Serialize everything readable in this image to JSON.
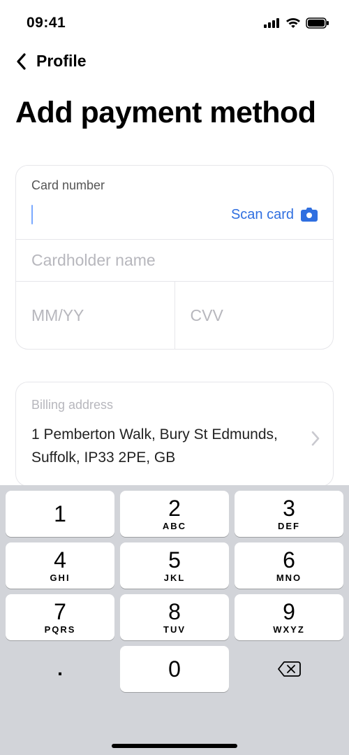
{
  "status": {
    "time": "09:41"
  },
  "nav": {
    "back_label": "Profile"
  },
  "title": "Add payment method",
  "form": {
    "card_number_label": "Card number",
    "scan_label": "Scan card",
    "cardholder_placeholder": "Cardholder name",
    "expiry_placeholder": "MM/YY",
    "cvv_placeholder": "CVV"
  },
  "billing": {
    "label": "Billing address",
    "value": "1 Pemberton Walk, Bury St Edmunds, Suffolk, IP33 2PE, GB"
  },
  "keypad": {
    "keys": [
      {
        "digit": "1",
        "letters": ""
      },
      {
        "digit": "2",
        "letters": "ABC"
      },
      {
        "digit": "3",
        "letters": "DEF"
      },
      {
        "digit": "4",
        "letters": "GHI"
      },
      {
        "digit": "5",
        "letters": "JKL"
      },
      {
        "digit": "6",
        "letters": "MNO"
      },
      {
        "digit": "7",
        "letters": "PQRS"
      },
      {
        "digit": "8",
        "letters": "TUV"
      },
      {
        "digit": "9",
        "letters": "WXYZ"
      }
    ],
    "period": ".",
    "zero": "0"
  }
}
